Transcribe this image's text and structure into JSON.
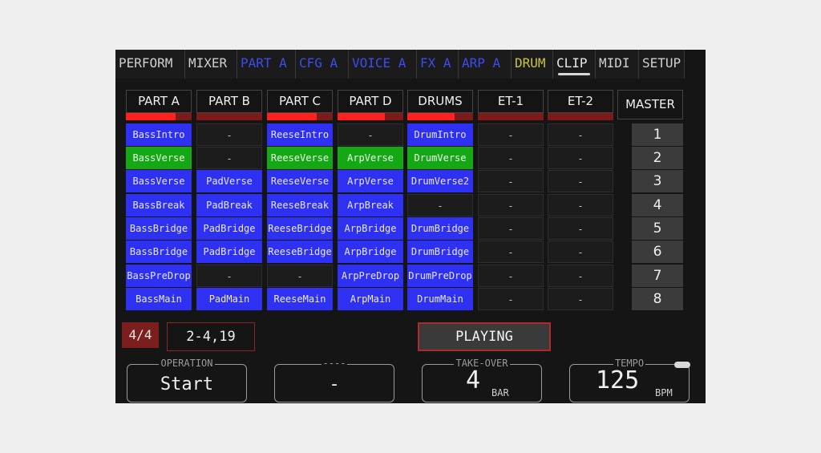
{
  "tabs": [
    {
      "label": "PERFORM",
      "color": "default",
      "active": false
    },
    {
      "label": "MIXER",
      "color": "default",
      "active": false
    },
    {
      "label": "PART A",
      "color": "blue",
      "active": false
    },
    {
      "label": "CFG A",
      "color": "blue",
      "active": false
    },
    {
      "label": "VOICE A",
      "color": "blue",
      "active": false
    },
    {
      "label": "FX A",
      "color": "blue",
      "active": false
    },
    {
      "label": "ARP A",
      "color": "blue",
      "active": false
    },
    {
      "label": "DRUM",
      "color": "yellow",
      "active": false
    },
    {
      "label": "CLIP",
      "color": "default",
      "active": true
    },
    {
      "label": "MIDI",
      "color": "default",
      "active": false
    },
    {
      "label": "SETUP",
      "color": "default",
      "active": false
    }
  ],
  "tracks": [
    {
      "name": "PART A",
      "level": 0.75,
      "clips": [
        {
          "label": "BassIntro",
          "state": "blue"
        },
        {
          "label": "BassVerse",
          "state": "green"
        },
        {
          "label": "BassVerse",
          "state": "blue"
        },
        {
          "label": "BassBreak",
          "state": "blue"
        },
        {
          "label": "BassBridge",
          "state": "blue"
        },
        {
          "label": "BassBridge",
          "state": "blue"
        },
        {
          "label": "BassPreDrop",
          "state": "blue"
        },
        {
          "label": "BassMain",
          "state": "blue"
        }
      ]
    },
    {
      "name": "PART B",
      "level": 0.0,
      "clips": [
        {
          "label": "-",
          "state": "empty"
        },
        {
          "label": "-",
          "state": "empty"
        },
        {
          "label": "PadVerse",
          "state": "blue"
        },
        {
          "label": "PadBreak",
          "state": "blue"
        },
        {
          "label": "PadBridge",
          "state": "blue"
        },
        {
          "label": "PadBridge",
          "state": "blue"
        },
        {
          "label": "-",
          "state": "empty"
        },
        {
          "label": "PadMain",
          "state": "blue"
        }
      ]
    },
    {
      "name": "PART C",
      "level": 0.75,
      "clips": [
        {
          "label": "ReeseIntro",
          "state": "blue"
        },
        {
          "label": "ReeseVerse",
          "state": "green"
        },
        {
          "label": "ReeseVerse",
          "state": "blue"
        },
        {
          "label": "ReeseBreak",
          "state": "blue"
        },
        {
          "label": "ReeseBridge",
          "state": "blue"
        },
        {
          "label": "ReeseBridge",
          "state": "blue"
        },
        {
          "label": "-",
          "state": "empty"
        },
        {
          "label": "ReeseMain",
          "state": "blue"
        }
      ]
    },
    {
      "name": "PART D",
      "level": 0.72,
      "clips": [
        {
          "label": "-",
          "state": "empty"
        },
        {
          "label": "ArpVerse",
          "state": "green"
        },
        {
          "label": "ArpVerse",
          "state": "blue"
        },
        {
          "label": "ArpBreak",
          "state": "blue"
        },
        {
          "label": "ArpBridge",
          "state": "blue"
        },
        {
          "label": "ArpBridge",
          "state": "blue"
        },
        {
          "label": "ArpPreDrop",
          "state": "blue"
        },
        {
          "label": "ArpMain",
          "state": "blue"
        }
      ]
    },
    {
      "name": "DRUMS",
      "level": 0.72,
      "clips": [
        {
          "label": "DrumIntro",
          "state": "blue"
        },
        {
          "label": "DrumVerse",
          "state": "green"
        },
        {
          "label": "DrumVerse2",
          "state": "blue"
        },
        {
          "label": "-",
          "state": "empty"
        },
        {
          "label": "DrumBridge",
          "state": "blue"
        },
        {
          "label": "DrumBridge",
          "state": "blue"
        },
        {
          "label": "DrumPreDrop",
          "state": "blue"
        },
        {
          "label": "DrumMain",
          "state": "blue"
        }
      ]
    },
    {
      "name": "ET-1",
      "level": 0.0,
      "clips": [
        {
          "label": "-",
          "state": "empty"
        },
        {
          "label": "-",
          "state": "empty"
        },
        {
          "label": "-",
          "state": "empty"
        },
        {
          "label": "-",
          "state": "empty"
        },
        {
          "label": "-",
          "state": "empty"
        },
        {
          "label": "-",
          "state": "empty"
        },
        {
          "label": "-",
          "state": "empty"
        },
        {
          "label": "-",
          "state": "empty"
        }
      ]
    },
    {
      "name": "ET-2",
      "level": 0.0,
      "clips": [
        {
          "label": "-",
          "state": "empty"
        },
        {
          "label": "-",
          "state": "empty"
        },
        {
          "label": "-",
          "state": "empty"
        },
        {
          "label": "-",
          "state": "empty"
        },
        {
          "label": "-",
          "state": "empty"
        },
        {
          "label": "-",
          "state": "empty"
        },
        {
          "label": "-",
          "state": "empty"
        },
        {
          "label": "-",
          "state": "empty"
        }
      ]
    }
  ],
  "master": {
    "label": "MASTER",
    "scenes": [
      "1",
      "2",
      "3",
      "4",
      "5",
      "6",
      "7",
      "8"
    ]
  },
  "status": {
    "time_signature": "4/4",
    "position": "2-4,19",
    "state": "PLAYING"
  },
  "knobs": {
    "operation": {
      "label": "OPERATION",
      "value": "Start"
    },
    "unassigned": {
      "label": "----",
      "value": "-"
    },
    "takeover": {
      "label": "TAKE-OVER",
      "value": "4",
      "unit": "BAR"
    },
    "tempo": {
      "label": "TEMPO",
      "value": "125",
      "unit": "BPM"
    }
  },
  "colors": {
    "clip_blue": "#2e31f2",
    "clip_green": "#15a815",
    "level_red": "#ff2020",
    "accent_red": "#b02a2a"
  }
}
